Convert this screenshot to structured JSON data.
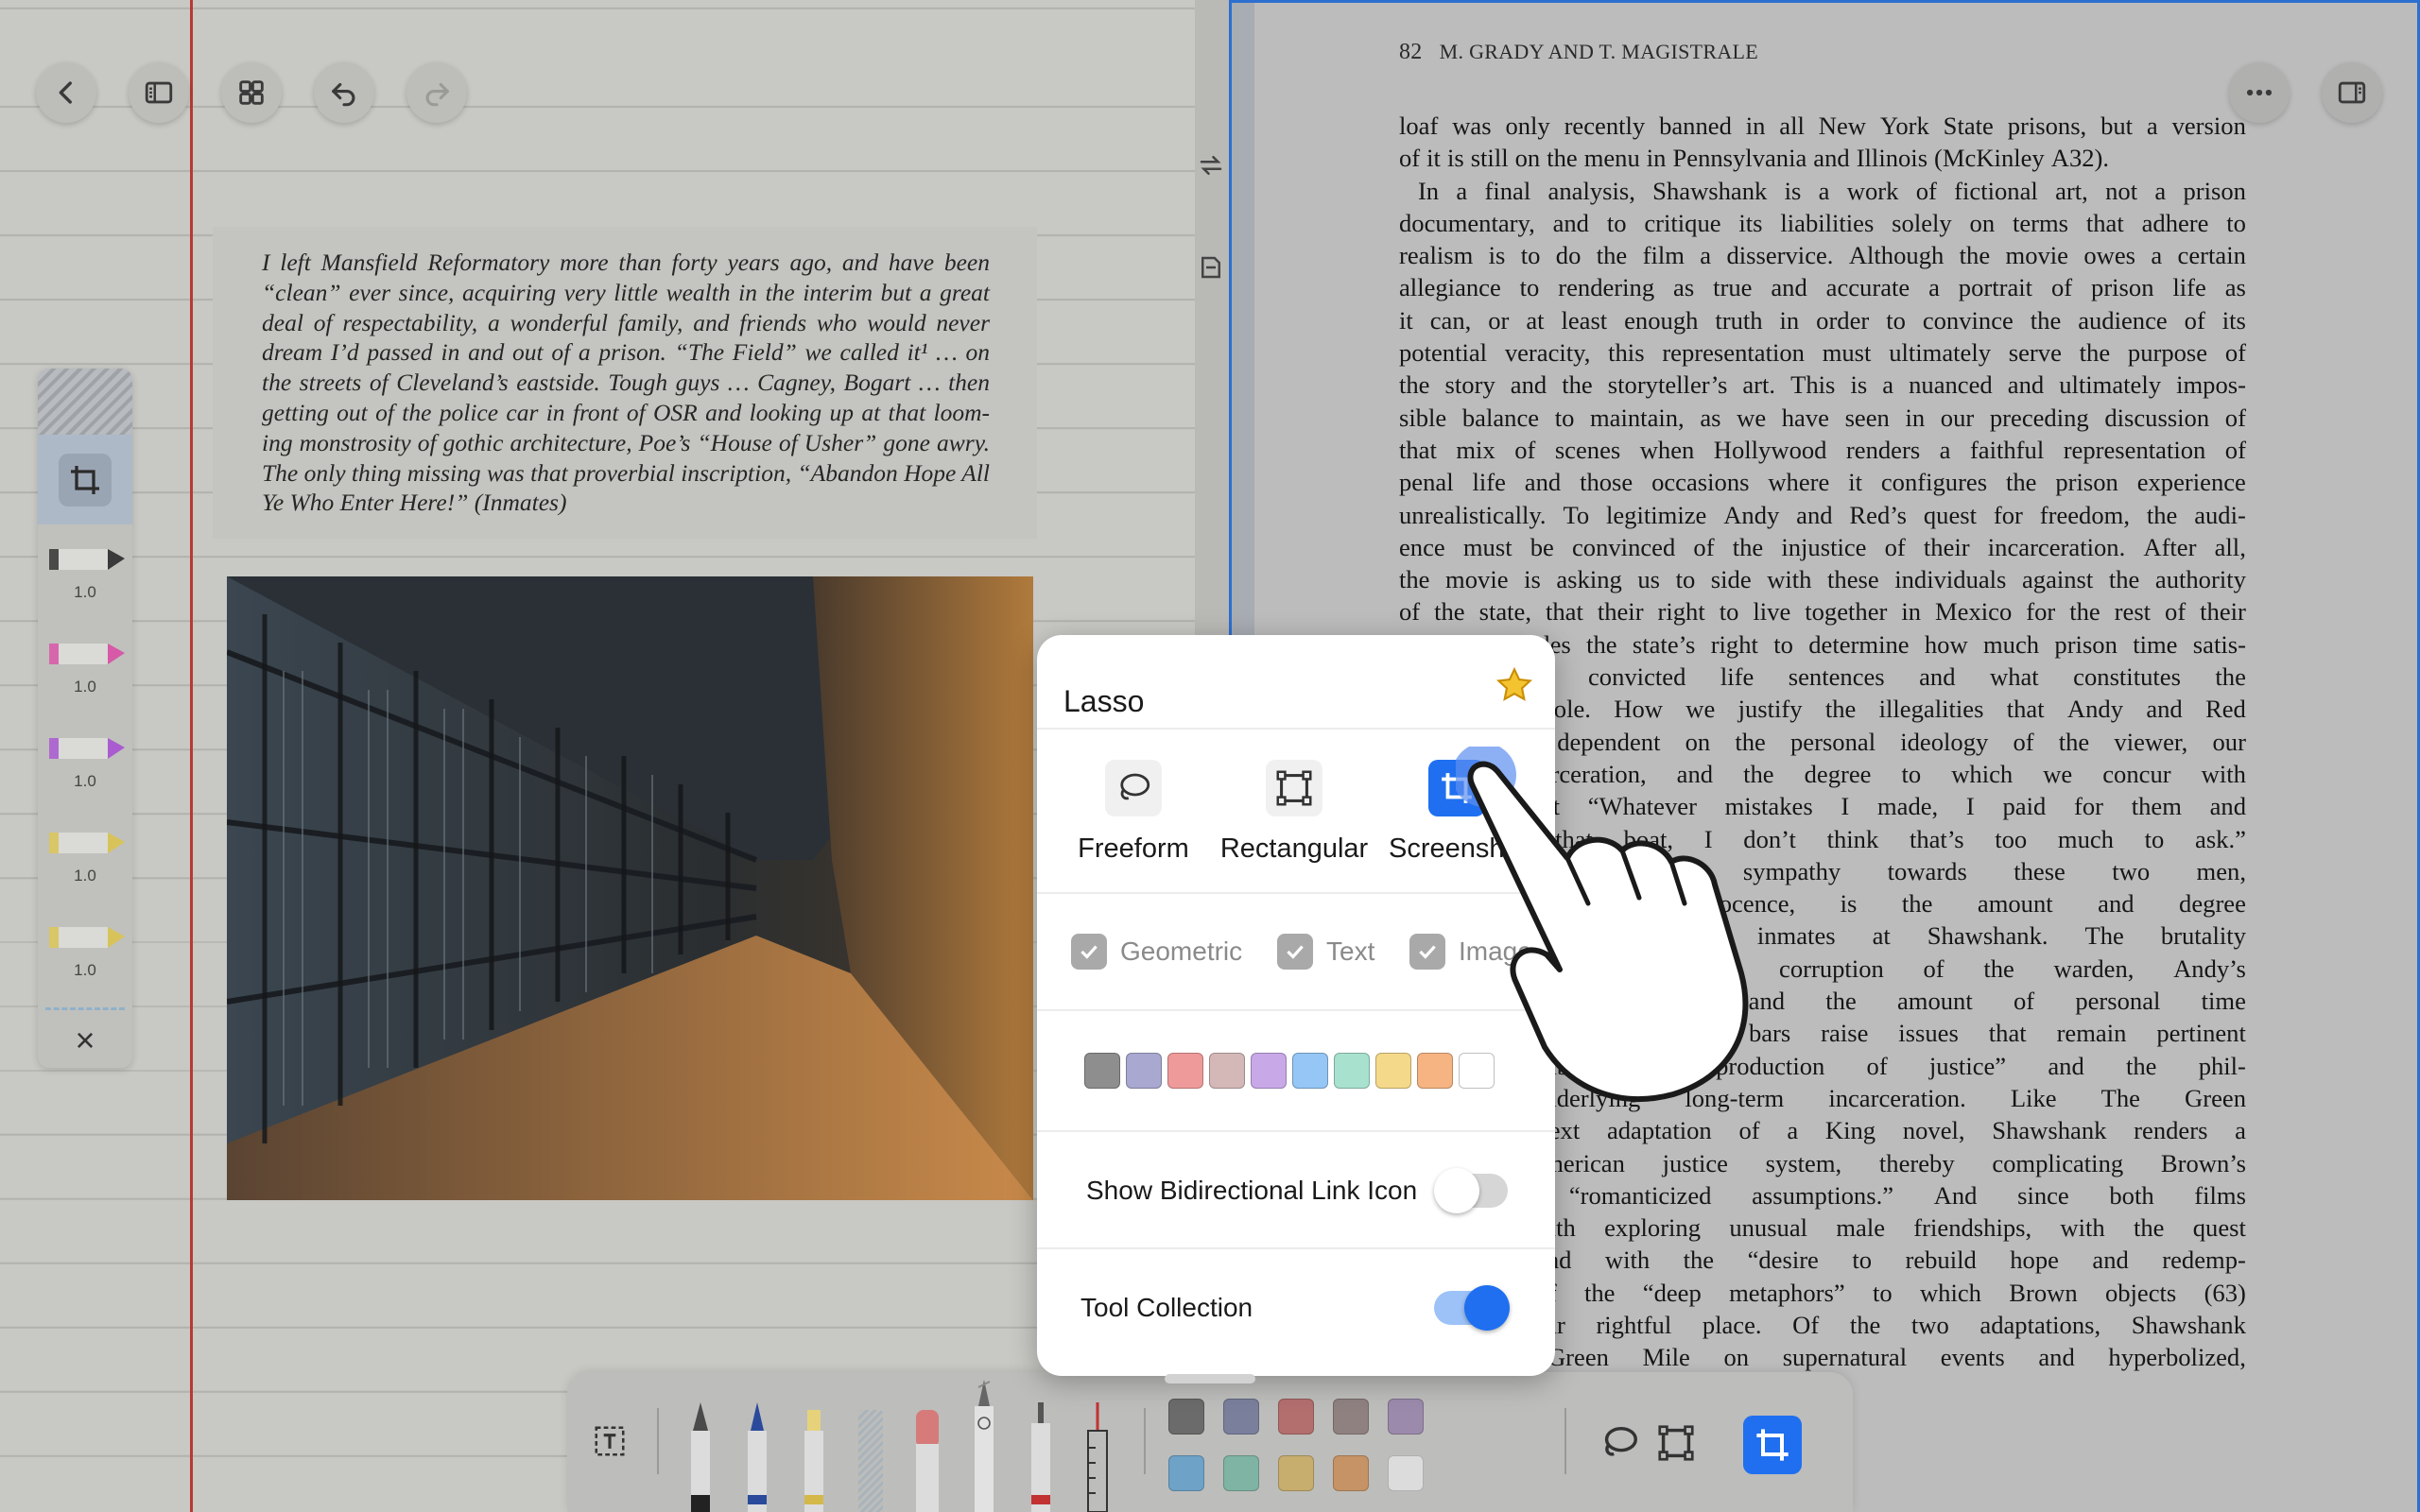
{
  "notebook": {
    "quote": "I left Mansfield Reformatory more than forty years ago, and have been “clean” ever since, acquiring very little wealth in the interim but a great deal of respectability, a wonderful family, and friends who would never dream I’d passed in and out of a prison. “The Field” we called it¹ … on the streets of Cleveland’s eastside. Tough guys … Cagney, Bogart … then getting out of the police car in front of OSR and looking up at that loom- ing monstrosity of gothic architecture, Poe’s “House of Usher” gone awry. The only thing missing was that proverbial inscription, “Abandon Hope All Ye Who Enter Here!” (Inmates)",
    "pens": [
      {
        "size": "1.0",
        "color": "#3a3a3a"
      },
      {
        "size": "1.0",
        "color": "#d65aa8"
      },
      {
        "size": "1.0",
        "color": "#a95ccf"
      },
      {
        "size": "1.0",
        "color": "#d8c35a"
      },
      {
        "size": "1.0",
        "color": "#d8c35a"
      }
    ],
    "close_label": "×"
  },
  "pdf": {
    "page_number": "82",
    "running_head": "M. GRADY AND T. MAGISTRALE",
    "lines": [
      "loaf was only recently banned in all New York State prisons, but a version",
      "of it is still on the menu in Pennsylvania and Illinois (McKinley A32).",
      "   In a final analysis, Shawshank is a work of fictional art, not a prison",
      "documentary, and to critique its liabilities solely on terms that adhere to",
      "realism is to do the film a disservice. Although the movie owes a certain",
      "allegiance to rendering as true and accurate a portrait of prison life as",
      "it can, or at least enough truth in order to convince the audience of its",
      "potential veracity, this representation must ultimately serve the purpose of",
      "the story and the storyteller’s art. This is a nuanced and ultimately impos-",
      "sible balance to maintain, as we have seen in our preceding discussion of",
      "that mix of scenes when Hollywood renders a faithful representation of",
      "penal life and those occasions where it configures the prison experience",
      "unrealistically. To legitimize Andy and Red’s quest for freedom, the audi-",
      "ence must be convinced of the injustice of their incarceration. After all,",
      "the movie is asking us to side with these individuals against the authority",
      "of the state, that their right to live together in Mexico for the rest of their",
      "lives supersedes the state’s right to determine how much prison time satis-",
      "fies wrongly convicted life sentences and what constitutes the",
      "terms of parole. How we justify the illegalities that Andy and Red",
      "however, is dependent on the personal ideology of the viewer, our",
      "towards incarceration, and the degree to which we concur with",
      "judgment that “Whatever mistakes I made, I paid for them and",
      "that hotel, that boat, I don’t think that’s too much to ask.”",
      "shapes the audience’s sympathy towards these two men,",
      "Andy’s fundamental innocence, is the amount and degree",
      "that they experience as inmates at Shawshank. The brutality",
      "and Captain Hadley, the corruption of the warden, Andy’s",
      "in solitary confinement, and the amount of personal time",
      "they have wasted behind bars raise issues that remain pertinent",
      "discussion about the production of justice” and the phil-",
      "rationale underlying long-term incarceration. Like The Green",
      "Darabont’s next adaptation of a King novel, Shawshank renders a",
      "of the American justice system, thereby complicating Brown’s",
      "the film’s “romanticized assumptions.” And since both films",
      "concerned with exploring unusual male friendships, with the quest",
      "liberation, and with the “desire to rebuild hope and redemp-",
      "conclusion of the “deep metaphors” to which Brown objects (63)",
      "deserved their rightful place. Of the two adaptations, Shawshank",
      "less than Green Mile on supernatural events and hyperbolized,"
    ]
  },
  "lasso_popup": {
    "title": "Lasso",
    "modes": [
      {
        "label": "Freeform",
        "icon": "lasso-freeform-icon",
        "active": false
      },
      {
        "label": "Rectangular",
        "icon": "rectangle-select-icon",
        "active": false
      },
      {
        "label": "Screenshot",
        "icon": "crop-screenshot-icon",
        "active": true
      }
    ],
    "filters": [
      {
        "label": "Geometric",
        "checked": true
      },
      {
        "label": "Text",
        "checked": true
      },
      {
        "label": "Image",
        "checked": true
      }
    ],
    "colors": [
      "#8e8e8e",
      "#a8a8d0",
      "#ef9a9a",
      "#d4b8b8",
      "#c9a8e8",
      "#95c6f5",
      "#a8e2cf",
      "#f5d98a",
      "#f6b483",
      "#ffffff"
    ],
    "show_link_icon_label": "Show Bidirectional Link Icon",
    "show_link_icon_on": false,
    "tool_collection_label": "Tool Collection",
    "tool_collection_on": true
  },
  "toolbar": {
    "colors": [
      "#6b6b6b",
      "#7a7f9c",
      "#b36e6e",
      "#8f8180",
      "#9b8aab",
      "#6ea2c7",
      "#7fb3a3",
      "#c7ad6e",
      "#c69366",
      "#dcdcdc"
    ],
    "accent": "#1f6ff0"
  }
}
